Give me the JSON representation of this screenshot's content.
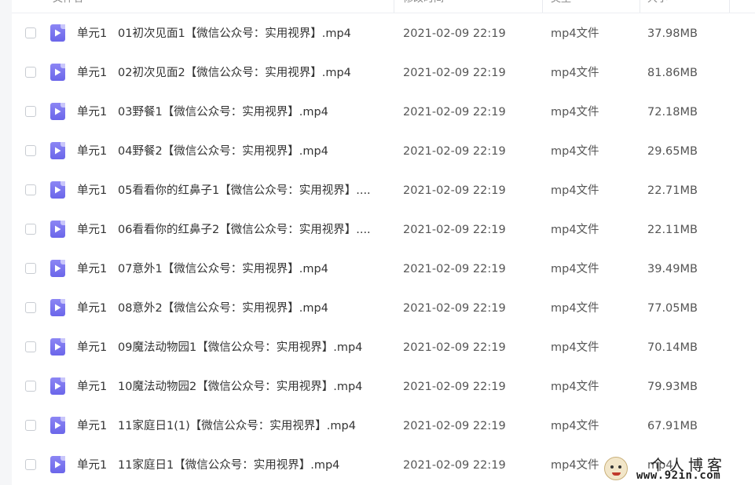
{
  "header": {
    "name_label": "文件名",
    "time_label": "修改时间",
    "type_label": "类型",
    "size_label": "大小"
  },
  "icons": {
    "file": "video-file-icon",
    "checkbox": "checkbox-icon",
    "sort": "sort-desc-icon"
  },
  "colors": {
    "file_icon": "#7b76f0",
    "background": "#ffffff"
  },
  "files": [
    {
      "name": "单元1   01初次见面1【微信公众号：实用视界】.mp4",
      "time": "2021-02-09 22:19",
      "type": "mp4文件",
      "size": "37.98MB"
    },
    {
      "name": "单元1   02初次见面2【微信公众号：实用视界】.mp4",
      "time": "2021-02-09 22:19",
      "type": "mp4文件",
      "size": "81.86MB"
    },
    {
      "name": "单元1   03野餐1【微信公众号：实用视界】.mp4",
      "time": "2021-02-09 22:19",
      "type": "mp4文件",
      "size": "72.18MB"
    },
    {
      "name": "单元1   04野餐2【微信公众号：实用视界】.mp4",
      "time": "2021-02-09 22:19",
      "type": "mp4文件",
      "size": "29.65MB"
    },
    {
      "name": "单元1   05看看你的红鼻子1【微信公众号：实用视界】....",
      "time": "2021-02-09 22:19",
      "type": "mp4文件",
      "size": "22.71MB"
    },
    {
      "name": "单元1   06看看你的红鼻子2【微信公众号：实用视界】....",
      "time": "2021-02-09 22:19",
      "type": "mp4文件",
      "size": "22.11MB"
    },
    {
      "name": "单元1   07意外1【微信公众号：实用视界】.mp4",
      "time": "2021-02-09 22:19",
      "type": "mp4文件",
      "size": "39.49MB"
    },
    {
      "name": "单元1   08意外2【微信公众号：实用视界】.mp4",
      "time": "2021-02-09 22:19",
      "type": "mp4文件",
      "size": "77.05MB"
    },
    {
      "name": "单元1   09魔法动物园1【微信公众号：实用视界】.mp4",
      "time": "2021-02-09 22:19",
      "type": "mp4文件",
      "size": "70.14MB"
    },
    {
      "name": "单元1   10魔法动物园2【微信公众号：实用视界】.mp4",
      "time": "2021-02-09 22:19",
      "type": "mp4文件",
      "size": "79.93MB"
    },
    {
      "name": "单元1   11家庭日1(1)【微信公众号：实用视界】.mp4",
      "time": "2021-02-09 22:19",
      "type": "mp4文件",
      "size": "67.91MB"
    },
    {
      "name": "单元1   11家庭日1【微信公众号：实用视界】.mp4",
      "time": "2021-02-09 22:19",
      "type": "mp4文件",
      "size": "mp4"
    }
  ],
  "watermark": {
    "title": "个人博客",
    "url": "www.92in.com"
  }
}
